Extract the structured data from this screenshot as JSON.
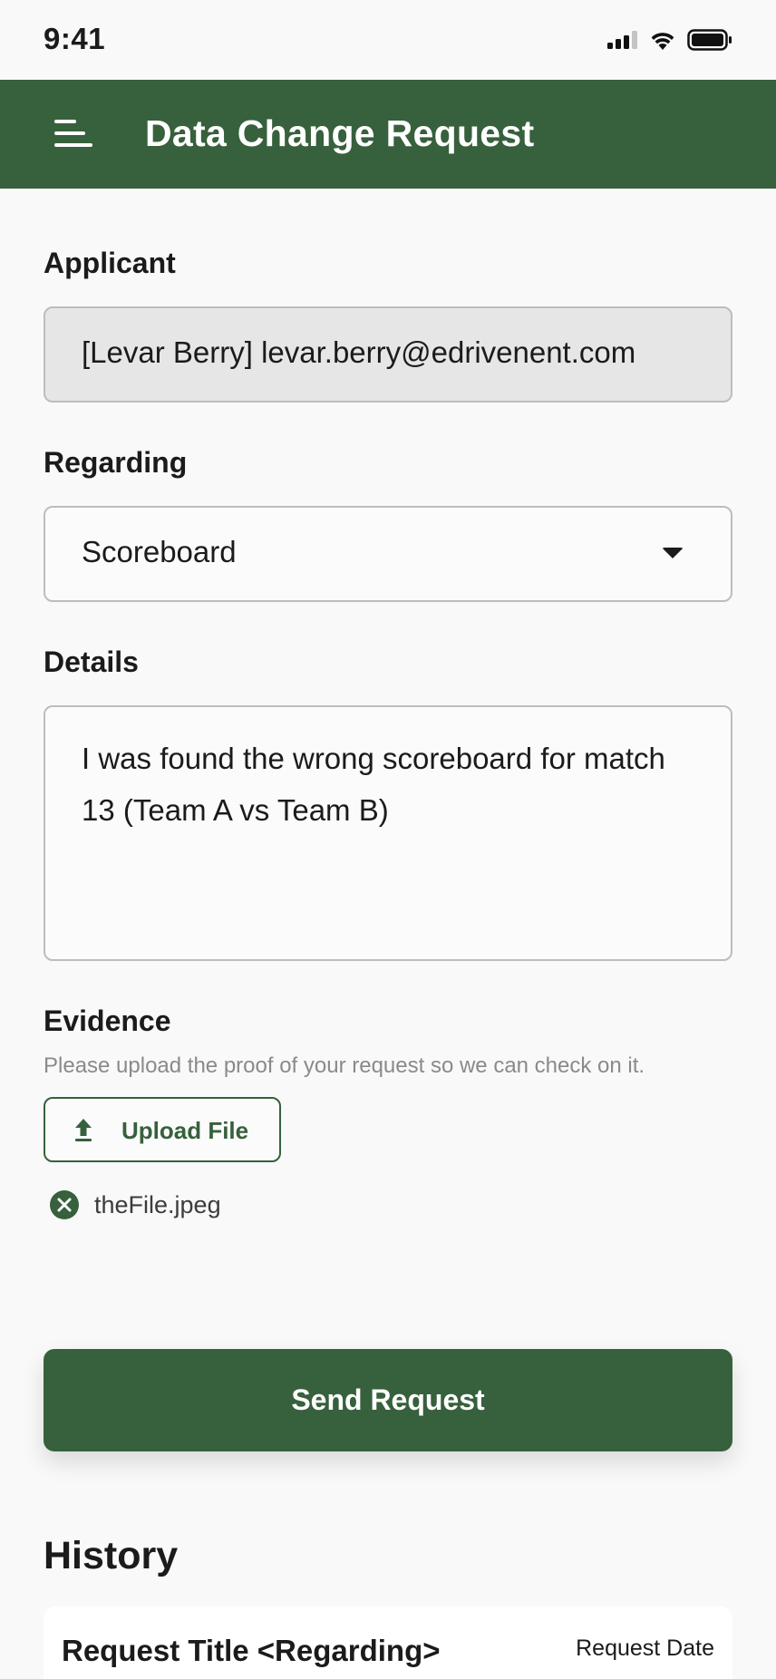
{
  "status_bar": {
    "time": "9:41",
    "icons": [
      "cellular-signal-icon",
      "wifi-icon",
      "battery-icon"
    ]
  },
  "app_bar": {
    "title": "Data Change Request",
    "menu_icon": "hamburger-menu-icon",
    "background_color": "#37603c"
  },
  "form": {
    "applicant": {
      "label": "Applicant",
      "value": "[Levar Berry] levar.berry@edrivenent.com"
    },
    "regarding": {
      "label": "Regarding",
      "selected": "Scoreboard"
    },
    "details": {
      "label": "Details",
      "value": "I was found the wrong scoreboard for match 13 (Team A vs Team B)"
    },
    "evidence": {
      "label": "Evidence",
      "help": "Please upload the proof of your request so we can check on it.",
      "upload_label": "Upload File",
      "files": [
        {
          "name": "theFile.jpeg"
        }
      ]
    },
    "submit_label": "Send Request"
  },
  "history": {
    "title": "History",
    "items": [
      {
        "title": "Request Title <Regarding>",
        "date": "Request Date"
      }
    ]
  },
  "colors": {
    "accent": "#37603c",
    "background": "#f9f9f9",
    "disabled_field": "#e6e6e6"
  }
}
